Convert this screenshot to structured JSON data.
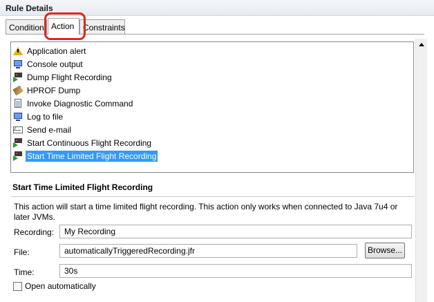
{
  "panel": {
    "title": "Rule Details"
  },
  "tabs": [
    {
      "label": "Condition"
    },
    {
      "label": "Action"
    },
    {
      "label": "Constraints"
    }
  ],
  "actions": [
    {
      "label": "Application alert",
      "icon": "alert-icon"
    },
    {
      "label": "Console output",
      "icon": "console-icon"
    },
    {
      "label": "Dump Flight Recording",
      "icon": "flight-recording-icon"
    },
    {
      "label": "HPROF Dump",
      "icon": "hprof-icon"
    },
    {
      "label": "Invoke Diagnostic Command",
      "icon": "diagnostic-command-icon"
    },
    {
      "label": "Log to file",
      "icon": "log-file-icon"
    },
    {
      "label": "Send e-mail",
      "icon": "email-icon"
    },
    {
      "label": "Start Continuous Flight Recording",
      "icon": "flight-recording-icon"
    },
    {
      "label": "Start Time Limited Flight Recording",
      "icon": "flight-recording-icon"
    }
  ],
  "details": {
    "title": "Start Time Limited Flight Recording",
    "description": "This action will start a time limited flight recording. This action only works when connected to Java 7u4 or later JVMs.",
    "recording_label": "Recording:",
    "recording_value": "My Recording",
    "file_label": "File:",
    "file_value": "automaticallyTriggeredRecording.jfr",
    "browse_label": "Browse...",
    "time_label": "Time:",
    "time_value": "30s",
    "open_auto_label": "Open automatically"
  },
  "colors": {
    "selection": "#3399ff",
    "highlight_ring": "#e0261f"
  }
}
